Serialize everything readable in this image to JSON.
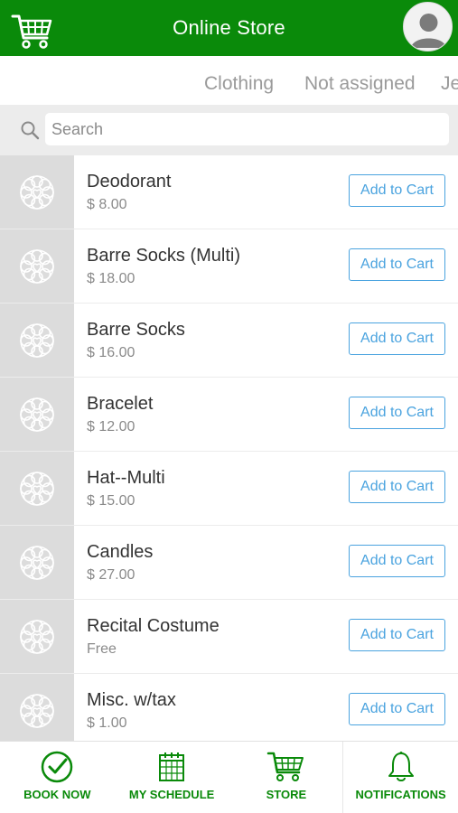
{
  "header": {
    "title": "Online Store",
    "cart_icon": "shopping-cart-icon",
    "avatar_icon": "user-avatar-icon",
    "bg_color": "#0a8a0a"
  },
  "categories": [
    "Clothing",
    "Not assigned",
    "Je"
  ],
  "search": {
    "placeholder": "Search",
    "value": ""
  },
  "products": [
    {
      "name": "Deodorant",
      "price": "$ 8.00",
      "button": "Add to Cart"
    },
    {
      "name": "Barre Socks (Multi)",
      "price": "$ 18.00",
      "button": "Add to Cart"
    },
    {
      "name": "Barre Socks",
      "price": "$ 16.00",
      "button": "Add to Cart"
    },
    {
      "name": "Bracelet",
      "price": "$ 12.00",
      "button": "Add to Cart"
    },
    {
      "name": "Hat--Multi",
      "price": "$ 15.00",
      "button": "Add to Cart"
    },
    {
      "name": "Candles",
      "price": "$ 27.00",
      "button": "Add to Cart"
    },
    {
      "name": "Recital Costume",
      "price": "Free",
      "button": "Add to Cart"
    },
    {
      "name": "Misc. w/tax",
      "price": "$ 1.00",
      "button": "Add to Cart"
    }
  ],
  "bottom_nav": [
    {
      "label": "BOOK NOW",
      "icon": "check-circle-icon"
    },
    {
      "label": "MY SCHEDULE",
      "icon": "calendar-icon"
    },
    {
      "label": "STORE",
      "icon": "cart-icon"
    },
    {
      "label": "NOTIFICATIONS",
      "icon": "bell-icon"
    }
  ],
  "colors": {
    "accent": "#0a8a0a",
    "button": "#4aa3df"
  }
}
